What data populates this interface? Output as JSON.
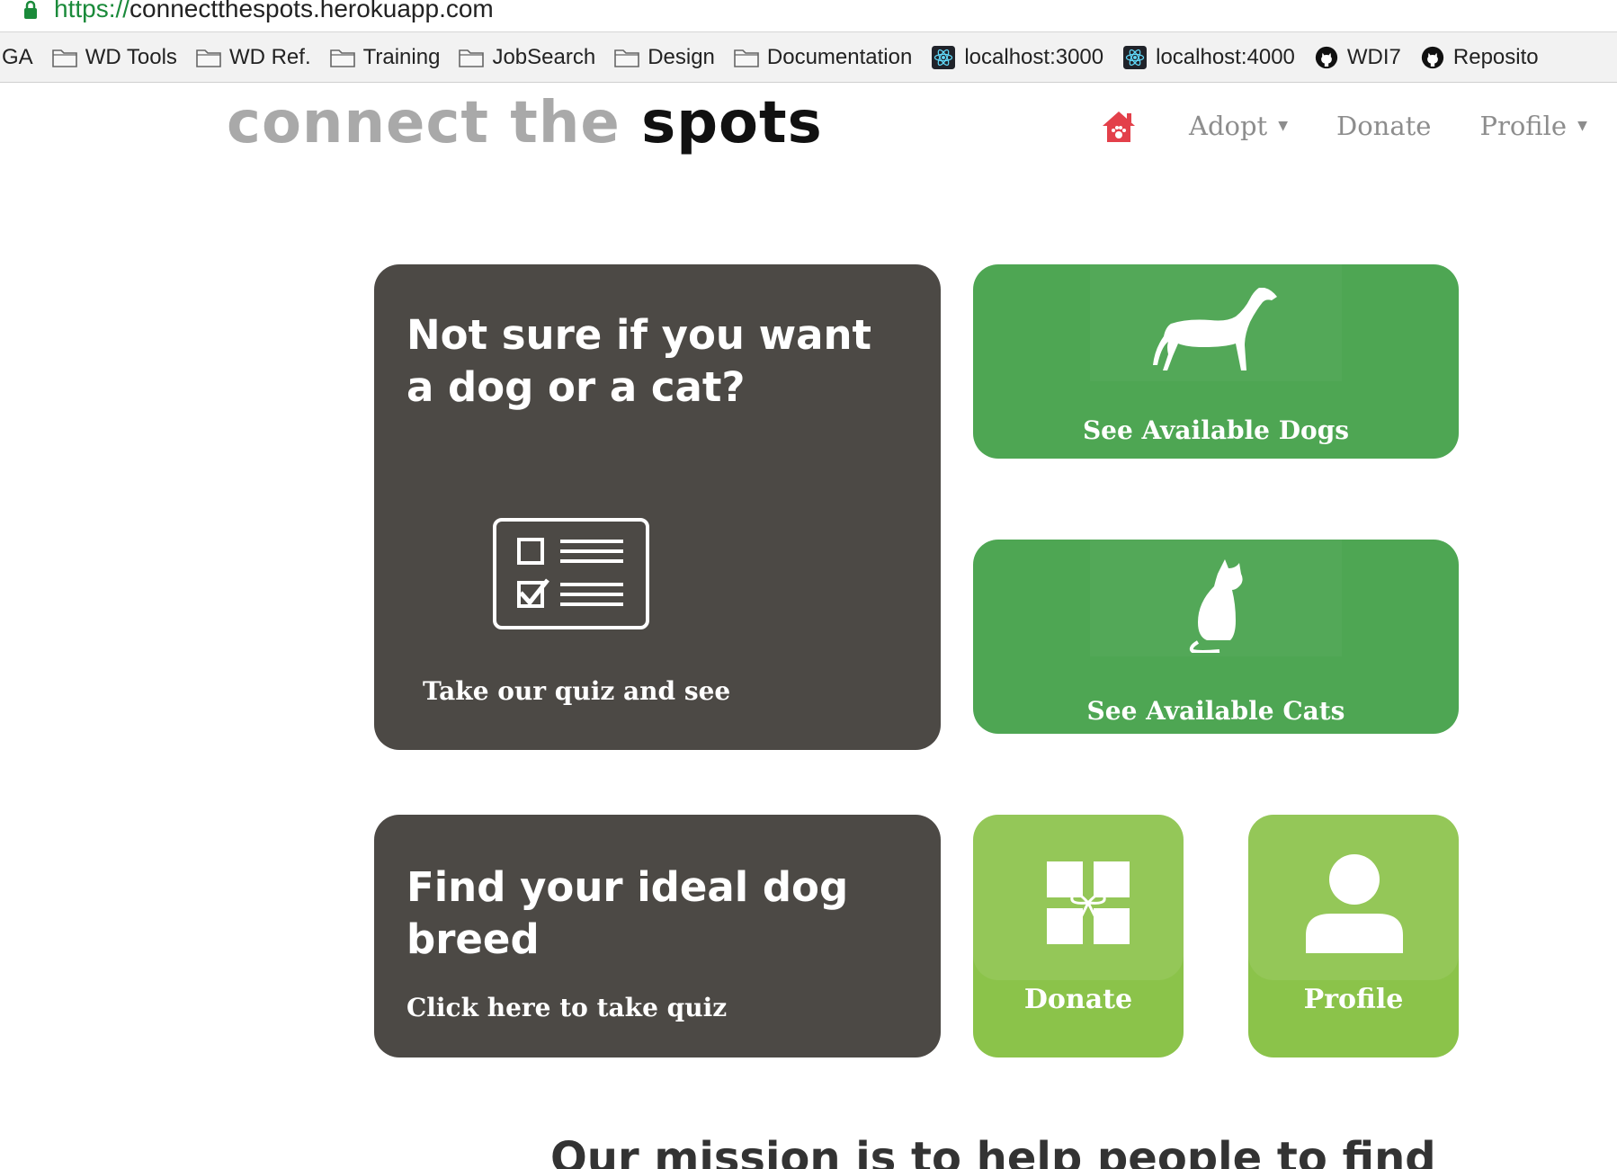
{
  "browser": {
    "url_scheme": "https://",
    "url_host": "connectthespots.herokuapp.com"
  },
  "bookmarks": [
    {
      "label": "GA",
      "icon": "none"
    },
    {
      "label": "WD Tools",
      "icon": "folder-icon"
    },
    {
      "label": "WD Ref.",
      "icon": "folder-icon"
    },
    {
      "label": "Training",
      "icon": "folder-icon"
    },
    {
      "label": "JobSearch",
      "icon": "folder-icon"
    },
    {
      "label": "Design",
      "icon": "folder-icon"
    },
    {
      "label": "Documentation",
      "icon": "folder-icon"
    },
    {
      "label": "localhost:3000",
      "icon": "react-icon"
    },
    {
      "label": "localhost:4000",
      "icon": "react-icon"
    },
    {
      "label": "WDI7",
      "icon": "github-icon"
    },
    {
      "label": "Reposito",
      "icon": "github-icon"
    }
  ],
  "header": {
    "logo_light": "connect the",
    "logo_dark": "spots",
    "nav": {
      "home_icon": "house-paw-icon",
      "adopt": "Adopt",
      "donate": "Donate",
      "profile": "Profile"
    }
  },
  "tiles": {
    "quiz": {
      "title": "Not sure if you want a dog or a cat?",
      "caption": "Take our quiz and see",
      "icon": "checklist-icon"
    },
    "dogs": {
      "caption": "See Available Dogs",
      "icon": "dog-icon"
    },
    "cats": {
      "caption": "See Available Cats",
      "icon": "cat-icon"
    },
    "breed": {
      "title": "Find your ideal dog breed",
      "caption": "Click here to take quiz"
    },
    "donate": {
      "caption": "Donate",
      "icon": "gift-icon"
    },
    "profile": {
      "caption": "Profile",
      "icon": "user-icon"
    }
  },
  "mission": "Our mission is to help people to find",
  "colors": {
    "tile_dark": "#4c4945",
    "tile_green": "#4ea653",
    "tile_lime": "#8bc34a",
    "logo_light": "#a9a9a9",
    "home_icon": "#e3404a"
  }
}
